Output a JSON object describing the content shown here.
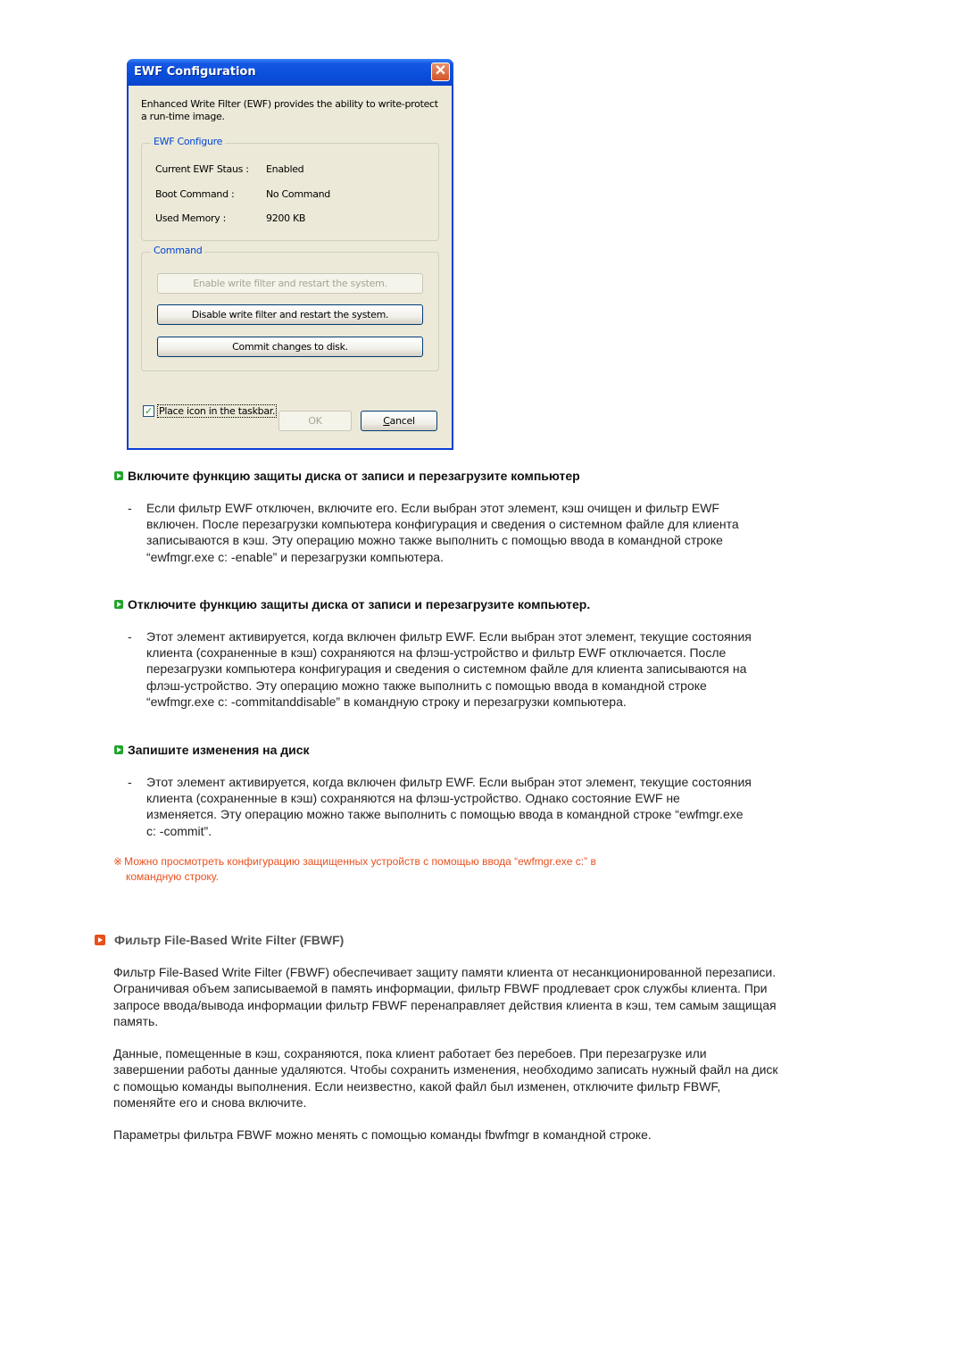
{
  "dialog": {
    "title": "EWF Configuration",
    "close_glyph": "✕",
    "description": "Enhanced Write Filter (EWF) provides the ability to write-protect a run-time image.",
    "configure_group": {
      "legend": "EWF Configure",
      "rows": [
        {
          "label": "Current EWF Staus :",
          "value": "Enabled"
        },
        {
          "label": "Boot Command :",
          "value": "No Command"
        },
        {
          "label": "Used Memory :",
          "value": "9200 KB"
        }
      ]
    },
    "command_group": {
      "legend": "Command",
      "buttons": [
        {
          "label": "Enable write filter and restart the system.",
          "enabled": false
        },
        {
          "label": "Disable write filter and restart the system.",
          "enabled": true
        },
        {
          "label": "Commit changes to disk.",
          "enabled": true
        }
      ]
    },
    "taskbar_checkbox": {
      "label": "Place icon in the taskbar.",
      "checked": true,
      "check_glyph": "✓"
    },
    "ok_label": "OK",
    "cancel_label_first": "C",
    "cancel_label_rest": "ancel"
  },
  "sections": [
    {
      "heading": "Включите функцию защиты диска от записи и перезагрузите компьютер",
      "dash": "-",
      "body": "Если фильтр EWF отключен, включите его. Если выбран этот элемент, кэш очищен и фильтр EWF включен. После перезагрузки компьютера конфигурация и сведения о системном файле для клиента записываются в кэш. Эту операцию можно также выполнить с помощью ввода в командной строке “ewfmgr.exe c: -enable” и перезагрузки компьютера."
    },
    {
      "heading": "Отключите функцию защиты диска от записи и перезагрузите компьютер.",
      "dash": "-",
      "body": "Этот элемент активируется, когда включен фильтр EWF. Если выбран этот элемент, текущие состояния клиента (сохраненные в кэш) сохраняются на флэш-устройство и фильтр EWF отключается. После перезагрузки компьютера конфигурация и сведения о системном файле для клиента записываются на флэш-устройство. Эту операцию можно также выполнить с помощью ввода в командной строке “ewfmgr.exe c: -commitanddisable” в командную строку и перезагрузки компьютера."
    },
    {
      "heading": "Запишите изменения на диск",
      "dash": "-",
      "body": "Этот элемент активируется, когда включен фильтр EWF. Если выбран этот элемент, текущие состояния клиента (сохраненные в кэш) сохраняются на флэш-устройство. Однако состояние EWF не изменяется. Эту операцию можно также выполнить с помощью ввода в командной строке “ewfmgr.exe c: -commit”."
    }
  ],
  "note": {
    "mark": "※",
    "line1": "Можно просмотреть конфигурацию защищенных устройств с помощью ввода “ewfmgr.exe c:” в",
    "line2": "командную строку."
  },
  "fbwf": {
    "heading": "Фильтр File-Based Write Filter (FBWF)",
    "paragraphs": [
      "Фильтр File-Based Write Filter (FBWF) обеспечивает защиту памяти клиента от несанкционированной перезаписи. Ограничивая объем записываемой в память информации, фильтр FBWF продлевает срок службы клиента. При запросе ввода/вывода информации фильтр FBWF перенаправляет действия клиента в кэш, тем самым защищая память.",
      "Данные, помещенные в кэш, сохраняются, пока клиент работает без перебоев. При перезагрузке или завершении работы данные удаляются. Чтобы сохранить изменения, необходимо записать нужный файл на диск с помощью команды выполнения. Если неизвестно, какой файл был изменен, отключите фильтр FBWF, поменяйте его и снова включите.",
      "Параметры фильтра FBWF можно менять с помощью команды fbwfmgr в командной строке."
    ]
  },
  "colors": {
    "accent_green": "#1fa52b",
    "accent_orange": "#e8501e",
    "xp_title_blue": "#0a4fdc"
  }
}
